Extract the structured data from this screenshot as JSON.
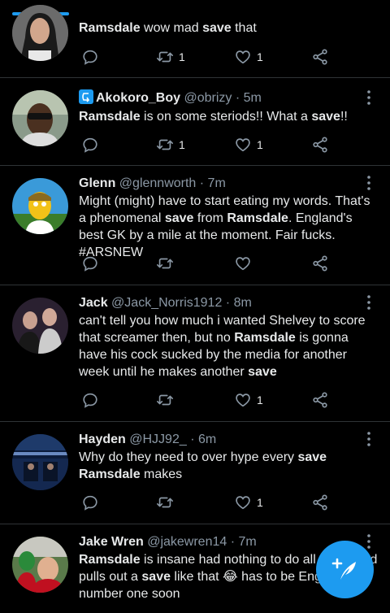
{
  "tweets": [
    {
      "name": "",
      "handle": "",
      "time": "",
      "text_segments": [
        {
          "t": "Ramsdale",
          "b": true
        },
        {
          "t": " wow mad ",
          "b": false
        },
        {
          "t": "save",
          "b": true
        },
        {
          "t": " that",
          "b": false
        }
      ],
      "retweets": "1",
      "likes": "1"
    },
    {
      "name": "Akokoro_Boy",
      "handle": "@obrizy",
      "time": "· 5m",
      "text_segments": [
        {
          "t": "Ramsdale",
          "b": true
        },
        {
          "t": " is on some steriods!! What a ",
          "b": false
        },
        {
          "t": "save",
          "b": true
        },
        {
          "t": "!!",
          "b": false
        }
      ],
      "retweets": "1",
      "likes": "1"
    },
    {
      "name": "Glenn",
      "handle": "@glennworth",
      "time": "· 7m",
      "text_segments": [
        {
          "t": "Might (might) have to start eating my words. That's a phenomenal ",
          "b": false
        },
        {
          "t": "save",
          "b": true
        },
        {
          "t": " from ",
          "b": false
        },
        {
          "t": "Ramsdale",
          "b": true
        },
        {
          "t": ". England's best GK by a mile at the moment. Fair fucks. #ARSNEW",
          "b": false
        }
      ],
      "retweets": "",
      "likes": ""
    },
    {
      "name": "Jack",
      "handle": "@Jack_Norris1912",
      "time": "· 8m",
      "text_segments": [
        {
          "t": "can't tell you how much i wanted Shelvey to score that screamer then, but no ",
          "b": false
        },
        {
          "t": "Ramsdale",
          "b": true
        },
        {
          "t": " is gonna have his cock sucked by the media for another week until he makes another ",
          "b": false
        },
        {
          "t": "save",
          "b": true
        }
      ],
      "retweets": "",
      "likes": "1"
    },
    {
      "name": "Hayden",
      "handle": "@HJJ92_",
      "time": "· 6m",
      "text_segments": [
        {
          "t": "Why do they need to over hype every ",
          "b": false
        },
        {
          "t": "save",
          "b": true
        },
        {
          "t": " ",
          "b": false
        },
        {
          "t": "Ramsdale",
          "b": true
        },
        {
          "t": " makes",
          "b": false
        }
      ],
      "retweets": "",
      "likes": "1"
    },
    {
      "name": "Jake Wren",
      "handle": "@jakewren14",
      "time": "· 7m",
      "text_segments": [
        {
          "t": "Ramsdale",
          "b": true
        },
        {
          "t": " is insane had nothing to do all game and pulls out a ",
          "b": false
        },
        {
          "t": "save",
          "b": true
        },
        {
          "t": " like that 😂 has to be England number one soon",
          "b": false
        }
      ],
      "retweets": "",
      "likes": ""
    }
  ],
  "icons": {
    "reply": "reply-icon",
    "retweet": "retweet-icon",
    "like": "heart-icon",
    "share": "share-icon",
    "more": "more-vertical-icon",
    "compose": "compose-tweet-icon"
  },
  "colors": {
    "background": "#000000",
    "accent": "#1d9bf0",
    "text": "#e7e9ea",
    "muted": "#8b98a5",
    "divider": "#2f3336"
  }
}
